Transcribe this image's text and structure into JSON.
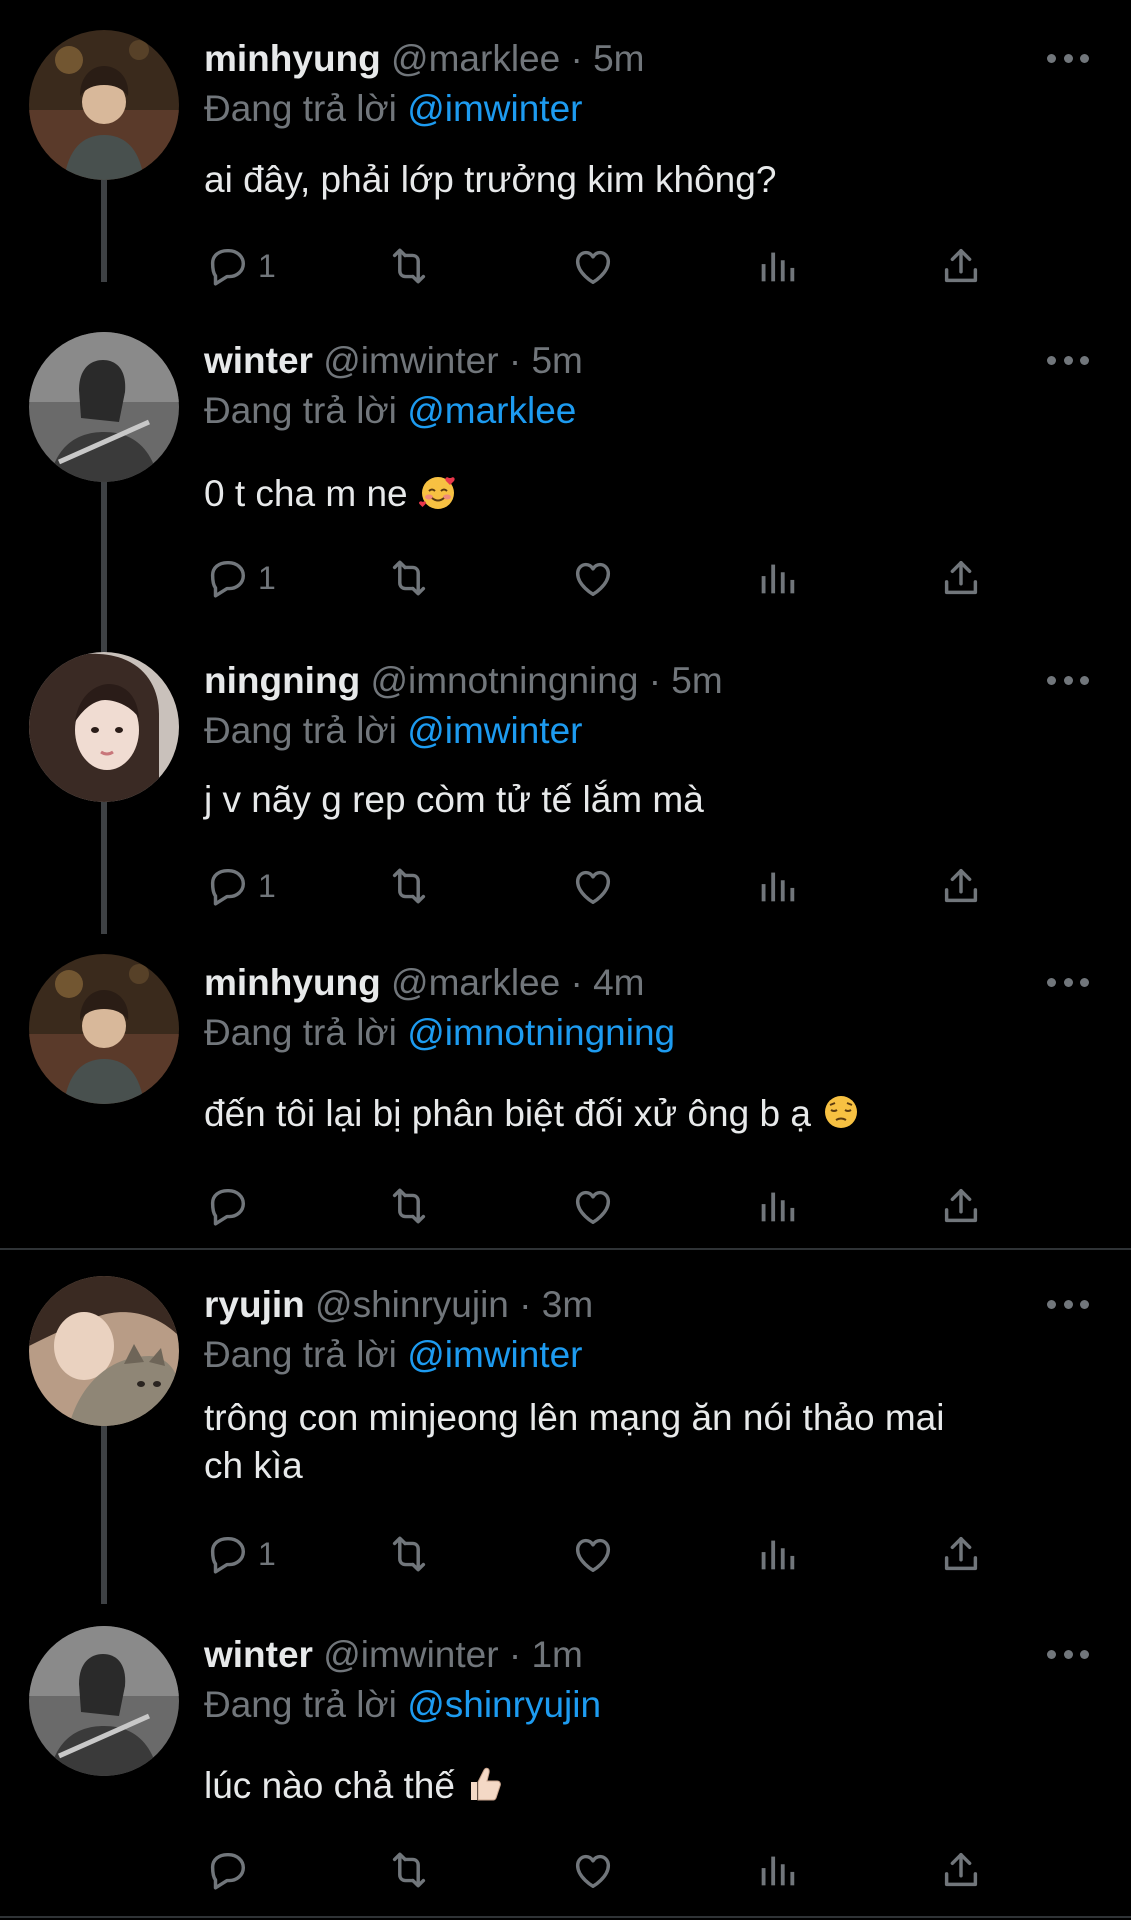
{
  "tweets": [
    {
      "name": "minhyung",
      "handle": "@marklee",
      "time": "5m",
      "reply_prefix": "Đang trả lời",
      "reply_to": "@imwinter",
      "text": "ai đây, phải lớp trưởng kim không?",
      "reply_count": "1"
    },
    {
      "name": "winter",
      "handle": "@imwinter",
      "time": "5m",
      "reply_prefix": "Đang trả lời",
      "reply_to": "@marklee",
      "text": "0 t cha m ne",
      "reply_count": "1"
    },
    {
      "name": "ningning",
      "handle": "@imnotningning",
      "time": "5m",
      "reply_prefix": "Đang trả lời",
      "reply_to": "@imwinter",
      "text": "j v nãy g rep còm tử tế lắm mà",
      "reply_count": "1"
    },
    {
      "name": "minhyung",
      "handle": "@marklee",
      "time": "4m",
      "reply_prefix": "Đang trả lời",
      "reply_to": "@imnotningning",
      "text": "đến tôi lại bị phân biệt đối xử ông b ạ",
      "reply_count": ""
    },
    {
      "name": "ryujin",
      "handle": "@shinryujin",
      "time": "3m",
      "reply_prefix": "Đang trả lời",
      "reply_to": "@imwinter",
      "text_line1": "trông con minjeong lên mạng ăn nói thảo mai",
      "text_line2": "ch kìa",
      "reply_count": "1"
    },
    {
      "name": "winter",
      "handle": "@imwinter",
      "time": "1m",
      "reply_prefix": "Đang trả lời",
      "reply_to": "@shinryujin",
      "text": "lúc nào chả thế",
      "reply_count": ""
    }
  ],
  "separator": "·",
  "icons": {
    "reply": "reply-icon",
    "retweet": "retweet-icon",
    "like": "heart-icon",
    "views": "views-icon",
    "share": "share-icon",
    "more": "more-icon"
  },
  "colors": {
    "background": "#000000",
    "text": "#e7e9ea",
    "muted": "#71767b",
    "link": "#1d9bf0"
  }
}
